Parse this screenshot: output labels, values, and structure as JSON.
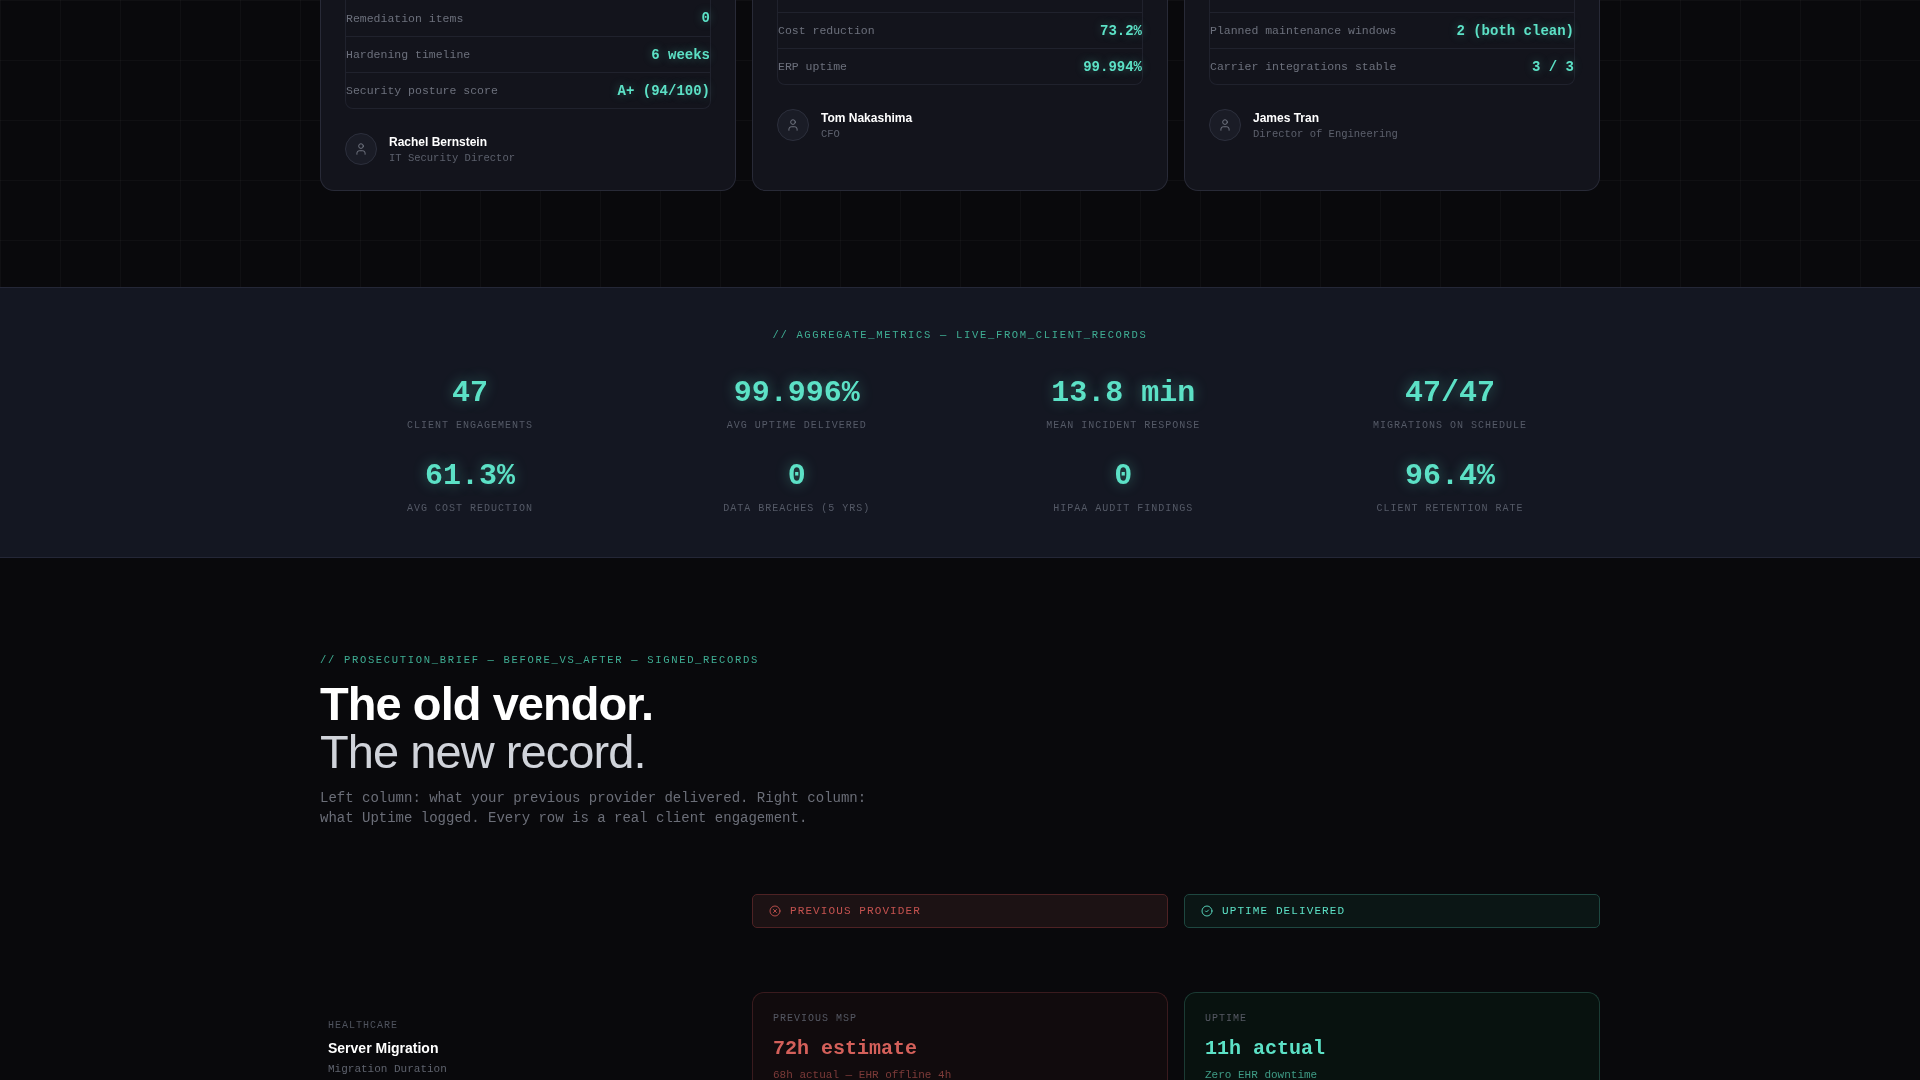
{
  "testimonial_cards": [
    {
      "rows": [
        {
          "label": "Remediation items",
          "value": "0"
        },
        {
          "label": "Hardening timeline",
          "value": "6 weeks"
        },
        {
          "label": "Security posture score",
          "value": "A+ (94/100)"
        }
      ],
      "person": {
        "name": "Rachel Bernstein",
        "role": "IT Security Director"
      }
    },
    {
      "rows": [
        {
          "label": "Cost reduction",
          "value": "73.2%"
        },
        {
          "label": "ERP uptime",
          "value": "99.994%"
        }
      ],
      "person": {
        "name": "Tom Nakashima",
        "role": "CFO"
      }
    },
    {
      "rows": [
        {
          "label": "Planned maintenance windows",
          "value": "2 (both clean)"
        },
        {
          "label": "Carrier integrations stable",
          "value": "3 / 3"
        }
      ],
      "person": {
        "name": "James Tran",
        "role": "Director of Engineering"
      }
    }
  ],
  "aggregate_metrics": {
    "tag": "// AGGREGATE_METRICS — LIVE_FROM_CLIENT_RECORDS",
    "metrics": [
      {
        "value": "47",
        "label": "CLIENT ENGAGEMENTS"
      },
      {
        "value": "99.996%",
        "label": "AVG UPTIME DELIVERED"
      },
      {
        "value": "13.8 min",
        "label": "MEAN INCIDENT RESPONSE"
      },
      {
        "value": "47/47",
        "label": "MIGRATIONS ON SCHEDULE"
      },
      {
        "value": "61.3%",
        "label": "AVG COST REDUCTION"
      },
      {
        "value": "0",
        "label": "DATA BREACHES (5 YRS)"
      },
      {
        "value": "0",
        "label": "HIPAA AUDIT FINDINGS"
      },
      {
        "value": "96.4%",
        "label": "CLIENT RETENTION RATE"
      }
    ]
  },
  "comparison": {
    "tag": "// PROSECUTION_BRIEF — BEFORE_VS_AFTER — SIGNED_RECORDS",
    "headline": "The old vendor.",
    "subheadline": "The new record.",
    "description": "Left column: what your previous provider delivered. Right column: what Uptime logged. Every row is a real client engagement.",
    "columns": [
      {
        "kind": "previous",
        "label": "PREVIOUS PROVIDER"
      },
      {
        "kind": "uptime",
        "label": "UPTIME DELIVERED"
      }
    ],
    "rows": [
      {
        "category": "HEALTHCARE",
        "title": "Server Migration",
        "metric": "Migration Duration",
        "cells": [
          {
            "kind": "previous",
            "label": "PREVIOUS MSP",
            "value": "72h estimate",
            "note": "68h actual — EHR offline 4h"
          },
          {
            "kind": "uptime",
            "label": "UPTIME",
            "value": "11h actual",
            "note": "Zero EHR downtime"
          }
        ]
      }
    ]
  }
}
